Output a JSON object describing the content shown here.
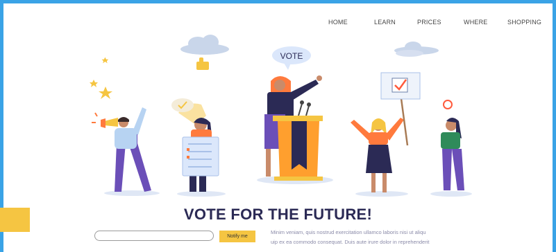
{
  "nav": {
    "items": [
      {
        "label": "HOME"
      },
      {
        "label": "LEARN"
      },
      {
        "label": "PRICES"
      },
      {
        "label": "WHERE"
      },
      {
        "label": "SHOPPING"
      }
    ]
  },
  "hero": {
    "speech_bubble": "VOTE",
    "title": "VOTE FOR THE FUTURE!"
  },
  "signup": {
    "email_value": "",
    "button_label": "Notify me"
  },
  "description": {
    "line1": "Minim veniam, quis nostrud exercitation ullamco laboris nisi ut aliqu",
    "line2": "uip ex ea commodo consequat. Duis aute irure dolor in reprehenderit"
  },
  "colors": {
    "frame_border": "#3aa3e6",
    "accent_yellow": "#f5c542",
    "title_navy": "#2b2a55",
    "purple": "#6b4fb8",
    "orange": "#ff7a3d"
  }
}
